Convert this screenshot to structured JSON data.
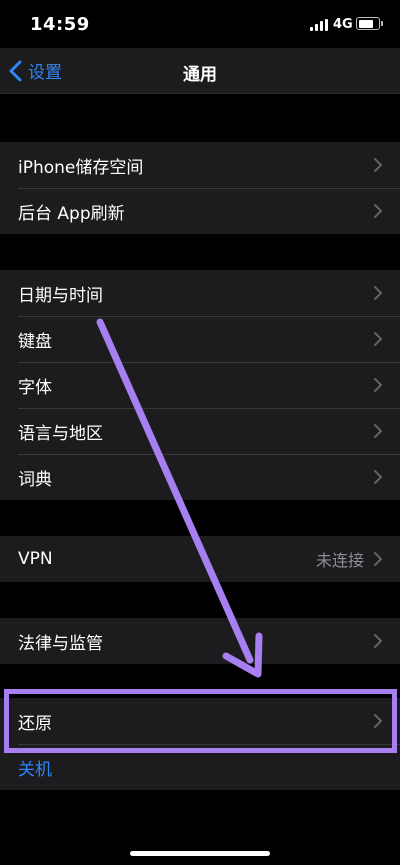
{
  "status": {
    "time": "14:59",
    "network": "4G",
    "battery_level": 0.8
  },
  "nav": {
    "back_label": "设置",
    "title": "通用"
  },
  "groups": {
    "storage": [
      "iPhone储存空间",
      "后台 App刷新"
    ],
    "locale": [
      "日期与时间",
      "键盘",
      "字体",
      "语言与地区",
      "词典"
    ],
    "vpn": {
      "label": "VPN",
      "status": "未连接"
    },
    "legal": "法律与监管",
    "reset": "还原",
    "shutdown": "关机"
  },
  "colors": {
    "accent": "#2f86f6",
    "annotation": "#a77ff0"
  }
}
